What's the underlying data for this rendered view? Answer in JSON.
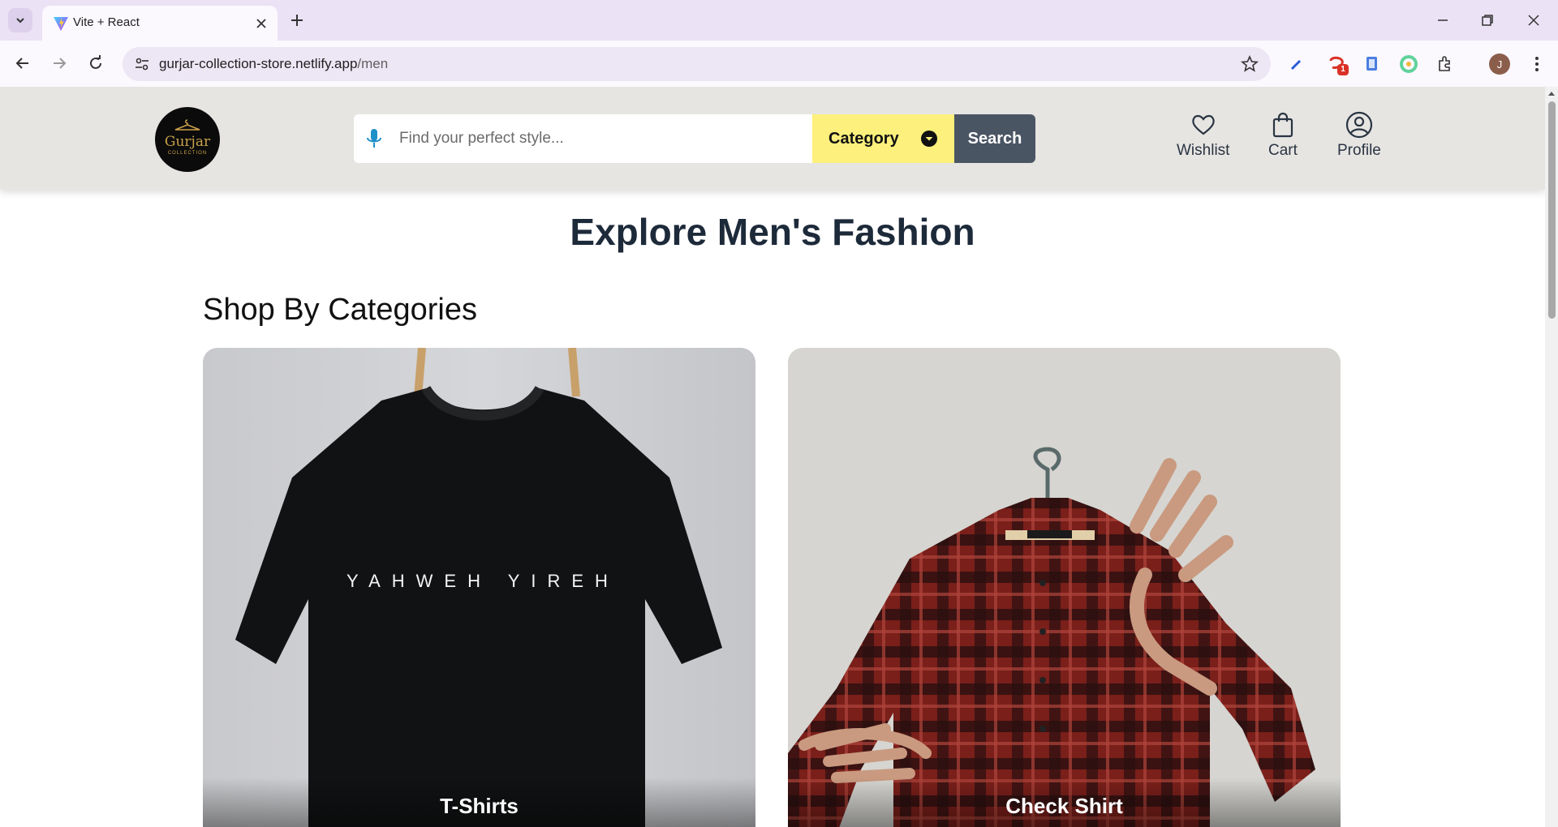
{
  "browser": {
    "tab_title": "Vite + React",
    "url_host": "gurjar-collection-store.netlify.app",
    "url_path": "/men",
    "extension_badge": "1",
    "profile_initial": "J",
    "icons": [
      "tab-list-icon",
      "vite-favicon",
      "close-icon",
      "plus-icon",
      "minimize-icon",
      "restore-icon",
      "window-close-icon",
      "back-icon",
      "forward-icon",
      "reload-icon",
      "site-info-icon",
      "star-icon",
      "extensions-icon",
      "kebab-menu-icon"
    ]
  },
  "header": {
    "logo_name": "Gurjar",
    "logo_sub": "COLLECTION",
    "search_placeholder": "Find your perfect style...",
    "category_label": "Category",
    "search_label": "Search",
    "actions": [
      {
        "label": "Wishlist",
        "icon": "heart-icon"
      },
      {
        "label": "Cart",
        "icon": "shopping-bag-icon"
      },
      {
        "label": "Profile",
        "icon": "user-circle-icon"
      }
    ]
  },
  "main": {
    "title": "Explore Men's Fashion",
    "section_title": "Shop By Categories",
    "categories": [
      {
        "label": "T-Shirts",
        "print_text": "YAHWEH YIREH"
      },
      {
        "label": "Check Shirt"
      }
    ]
  },
  "colors": {
    "header_bg": "#e6e5e2",
    "category_bg": "#fdf07c",
    "search_btn_bg": "#4a5564",
    "title_color": "#1d2a3a",
    "mic_color": "#1e90c8"
  }
}
